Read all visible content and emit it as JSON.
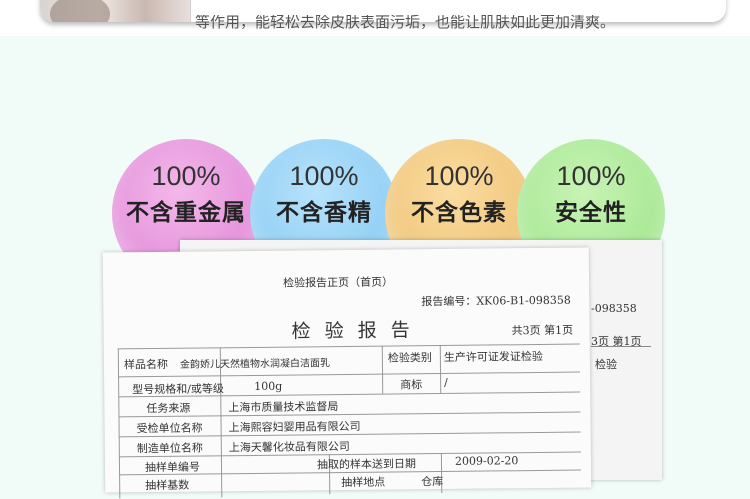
{
  "top_banner": {
    "text": "等作用，能轻松去除皮肤表面污垢，也能让肌肤如此更加清爽。"
  },
  "badges": [
    {
      "percent": "100%",
      "label": "不含重金属",
      "color": "#e28fda"
    },
    {
      "percent": "100%",
      "label": "不含香精",
      "color": "#8dcdf4"
    },
    {
      "percent": "100%",
      "label": "不含色素",
      "color": "#efc57a"
    },
    {
      "percent": "100%",
      "label": "安全性",
      "color": "#a6e792"
    }
  ],
  "report_back": {
    "report_no": "-098358",
    "pages": "3页  第1页",
    "category": "检验"
  },
  "report": {
    "cover_title": "检验报告正页（首页）",
    "report_no": "报告编号：XK06-B1-098358",
    "title": "检 验 报 告",
    "pages": "共3页  第1页",
    "rows": {
      "sample_name_label": "样品名称",
      "sample_name_value": "金韵娇儿天然植物水润凝白洁面乳",
      "check_type_label": "检验类别",
      "check_type_value": "生产许可证发证检验",
      "spec_label": "型号规格和/或等级",
      "spec_value": "100g",
      "brand_label": "商标",
      "brand_value": "/",
      "task_source_label": "任务来源",
      "task_source_value": "上海市质量技术监督局",
      "inspected_label": "受检单位名称",
      "inspected_value": "上海熙容妇婴用品有限公司",
      "maker_label": "制造单位名称",
      "maker_value": "上海天馨化妆品有限公司",
      "sample_no_label": "抽样单编号",
      "arrival_label": "抽取的样本送到日期",
      "arrival_value": "2009-02-20",
      "base_label": "抽样基数",
      "place_label": "抽样地点",
      "place_value": "仓库"
    }
  }
}
